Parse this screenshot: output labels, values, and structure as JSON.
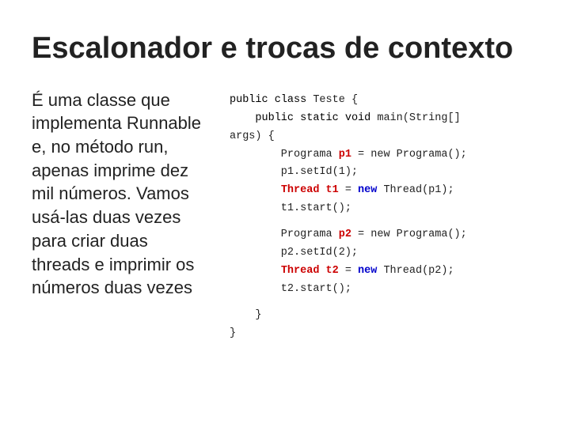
{
  "slide": {
    "title": "Escalonador e trocas de contexto",
    "left_text": "É uma classe que implementa Runnable e, no método run, apenas imprime dez mil números. Vamos usá-las duas vezes para criar duas threads e imprimir os números duas vezes",
    "code": {
      "lines": [
        {
          "id": "l1",
          "text": "public class Teste {"
        },
        {
          "id": "l2",
          "text": "    public static void main(String[]"
        },
        {
          "id": "l3",
          "text": "args) {"
        },
        {
          "id": "l4",
          "text": "        Programa ",
          "var": "p1",
          "rest": " = new Programa();"
        },
        {
          "id": "l5",
          "text": "        p1.setId(1);"
        },
        {
          "id": "l6",
          "text": "        Thread ",
          "var": "t1",
          "rest2a": " = ",
          "new2": "new",
          "rest2b": " Thread(p1);"
        },
        {
          "id": "l7",
          "text": "        t1.start();"
        },
        {
          "id": "l8",
          "text": ""
        },
        {
          "id": "l9",
          "text": "        Programa ",
          "var2": "p2",
          "rest3": " = new Programa();"
        },
        {
          "id": "l10",
          "text": "        p2.setId(2);"
        },
        {
          "id": "l11",
          "text": "        Thread ",
          "var3": "t2",
          "rest4a": " = ",
          "new4": "new",
          "rest4b": " Thread(p2);"
        },
        {
          "id": "l12",
          "text": "        t2.start();"
        },
        {
          "id": "l13",
          "text": ""
        },
        {
          "id": "l14",
          "text": "    }"
        },
        {
          "id": "l15",
          "text": "}"
        }
      ]
    }
  }
}
